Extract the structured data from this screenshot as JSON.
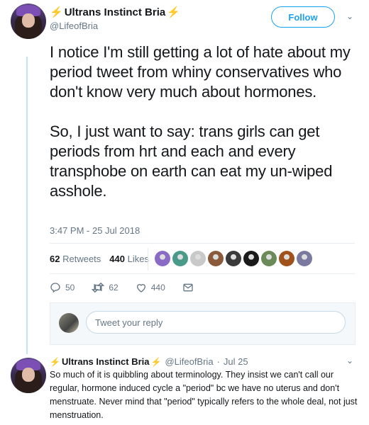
{
  "main_tweet": {
    "display_name": "Ultrans Instinct Bria",
    "handle": "@LifeofBria",
    "follow_label": "Follow",
    "text": "I notice I'm still getting a lot of hate about my period tweet from whiny conservatives who don't know very much about hormones.\n\nSo, I just want to say: trans girls can get periods from hrt and each and every transphobe on earth can eat my un-wiped asshole.",
    "timestamp": "3:47 PM - 25 Jul 2018",
    "retweets_count": "62",
    "retweets_label": "Retweets",
    "likes_count": "440",
    "likes_label": "Likes",
    "actions": {
      "replies": "50",
      "retweets": "62",
      "likes": "440"
    },
    "liker_colors": [
      "#8a6cc7",
      "#4a9a8a",
      "#c9c9c9",
      "#8a5a3a",
      "#3a3a3a",
      "#1a1a1a",
      "#6a8a5a",
      "#a0521a",
      "#7a7aa0"
    ]
  },
  "reply_box": {
    "placeholder": "Tweet your reply"
  },
  "reply_tweet": {
    "display_name": "Ultrans Instinct Bria",
    "handle": "@LifeofBria",
    "separator": "·",
    "date": "Jul 25",
    "text": "So much of it is quibbling about terminology. They insist we can't call our regular, hormone induced cycle a \"period\" bc we have no uterus and don't menstruate. Never mind that \"period\" typically refers to the whole deal, not just menstruation."
  },
  "colors": {
    "accent": "#1da1f2",
    "muted": "#657786",
    "bolt": "#f7b500",
    "thread_line": "#c4e5f8"
  },
  "icons": [
    "bolt-icon",
    "chevron-down-icon",
    "reply-icon",
    "retweet-icon",
    "heart-icon",
    "message-icon"
  ]
}
